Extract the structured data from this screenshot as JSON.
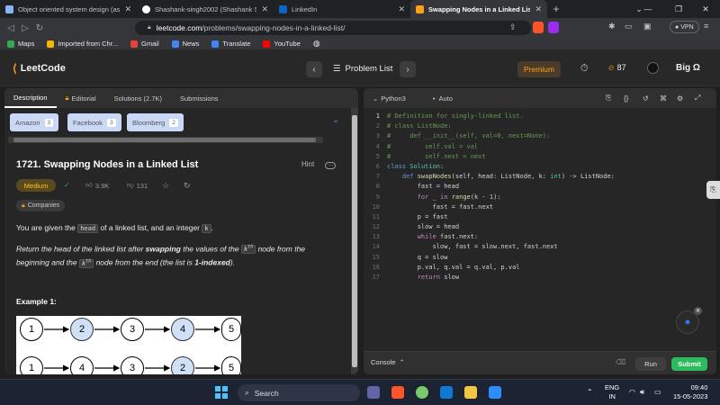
{
  "browser": {
    "tabs": [
      {
        "title": "Object oriented system design (askbo",
        "icon": "doc-icon",
        "color": "#8ab4f8"
      },
      {
        "title": "Shashank-singh2002 (Shashank Singh)",
        "icon": "github-icon",
        "color": "#ffffff"
      },
      {
        "title": "LinkedIn",
        "icon": "linkedin-icon",
        "color": "#0a66c2"
      },
      {
        "title": "Swapping Nodes in a Linked List",
        "icon": "leetcode-icon",
        "color": "#ffa116"
      }
    ],
    "url_host": "leetcode.com",
    "url_path": "/problems/swapping-nodes-in-a-linked-list/",
    "vpn_label": "VPN",
    "bookmarks": [
      {
        "label": "Maps",
        "color": "#34a853"
      },
      {
        "label": "Imported from Chr...",
        "color": "#f4b400"
      },
      {
        "label": "Gmail",
        "color": "#ea4335"
      },
      {
        "label": "News",
        "color": "#4285f4"
      },
      {
        "label": "Translate",
        "color": "#4285f4"
      },
      {
        "label": "YouTube",
        "color": "#ff0000"
      }
    ]
  },
  "header": {
    "logo": "LeetCode",
    "problem_list": "Problem List",
    "premium": "Premium",
    "streak": "87",
    "user": "Big Ω"
  },
  "left": {
    "tabs": [
      "Description",
      "Editorial",
      "Solutions (2.7K)",
      "Submissions"
    ],
    "companies": [
      {
        "name": "Amazon",
        "count": "3"
      },
      {
        "name": "Facebook",
        "count": "3"
      },
      {
        "name": "Bloomberg",
        "count": "2"
      }
    ],
    "title": "1721. Swapping Nodes in a Linked List",
    "hint": "Hint",
    "difficulty": "Medium",
    "likes": "3.9K",
    "dislikes": "131",
    "companies_label": "Companies",
    "p1_a": "You are given the ",
    "p1_code1": "head",
    "p1_b": " of a linked list, and an integer ",
    "p1_code2": "k",
    "p1_c": ".",
    "p2_a": "Return the head of the linked list after ",
    "p2_b": "swapping",
    "p2_c": " the values of the ",
    "p2_k": "k",
    "p2_th": "th",
    "p2_d": " node from the",
    "p2_e": "beginning and the ",
    "p2_f": " node from the end (the list is ",
    "p2_g": "1-indexed",
    "p2_h": ").",
    "example_title": "Example 1:",
    "list_before": [
      "1",
      "2",
      "3",
      "4",
      "5"
    ],
    "list_after": [
      "1",
      "4",
      "3",
      "2",
      "5"
    ]
  },
  "editor": {
    "language": "Python3",
    "mode": "Auto",
    "lines": [
      [
        [
          "c-cm",
          "# Definition for singly-linked list."
        ]
      ],
      [
        [
          "c-cm",
          "# class ListNode:"
        ]
      ],
      [
        [
          "c-cm",
          "#     def __init__(self, val=0, next=None):"
        ]
      ],
      [
        [
          "c-cm",
          "#         self.val = val"
        ]
      ],
      [
        [
          "c-cm",
          "#         self.next = next"
        ]
      ],
      [
        [
          "c-kw",
          "class "
        ],
        [
          "c-ty",
          "Solution"
        ],
        [
          "c-tx",
          ":"
        ]
      ],
      [
        [
          "c-tx",
          "    "
        ],
        [
          "c-kw",
          "def "
        ],
        [
          "c-fn",
          "swapNodes"
        ],
        [
          "c-tx",
          "(self, head: ListNode, k: "
        ],
        [
          "c-ty",
          "int"
        ],
        [
          "c-tx",
          ") -> ListNode:"
        ]
      ],
      [
        [
          "c-tx",
          "        fast = head"
        ]
      ],
      [
        [
          "c-tx",
          "        "
        ],
        [
          "c-kw2",
          "for"
        ],
        [
          "c-tx",
          " _ "
        ],
        [
          "c-kw2",
          "in"
        ],
        [
          "c-tx",
          " "
        ],
        [
          "c-fn",
          "range"
        ],
        [
          "c-tx",
          "(k - "
        ],
        [
          "c-nm",
          "1"
        ],
        [
          "c-tx",
          "):"
        ]
      ],
      [
        [
          "c-tx",
          "            fast = fast.next"
        ]
      ],
      [
        [
          "c-tx",
          "        p = fast"
        ]
      ],
      [
        [
          "c-tx",
          "        slow = head"
        ]
      ],
      [
        [
          "c-tx",
          "        "
        ],
        [
          "c-kw2",
          "while"
        ],
        [
          "c-tx",
          " fast.next:"
        ]
      ],
      [
        [
          "c-tx",
          "            slow, fast = slow.next, fast.next"
        ]
      ],
      [
        [
          "c-tx",
          "        q = slow"
        ]
      ],
      [
        [
          "c-tx",
          "        p.val, q.val = q.val, p.val"
        ]
      ],
      [
        [
          "c-tx",
          "        "
        ],
        [
          "c-kw2",
          "return"
        ],
        [
          "c-tx",
          " slow"
        ]
      ]
    ],
    "console": "Console",
    "run": "Run",
    "submit": "Submit"
  },
  "taskbar": {
    "search": "Search",
    "lang1": "ENG",
    "lang2": "IN",
    "time": "09:40",
    "date": "15-05-2023"
  }
}
